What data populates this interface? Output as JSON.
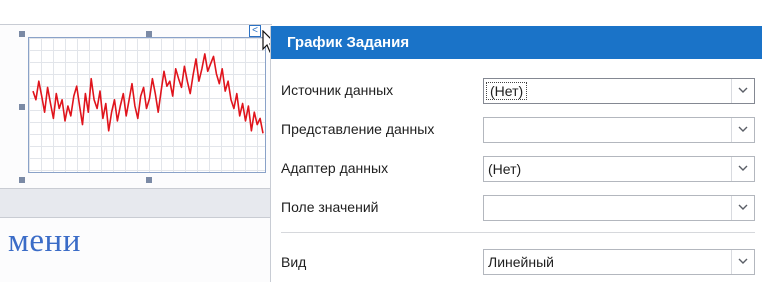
{
  "designer": {
    "footer_text": "мени",
    "smart_tag_glyph": "<"
  },
  "panel": {
    "title": "График Задания",
    "rows": [
      {
        "label": "Источник данных",
        "value": "(Нет)"
      },
      {
        "label": "Представление данных",
        "value": ""
      },
      {
        "label": "Адаптер данных",
        "value": "(Нет)"
      },
      {
        "label": "Поле значений",
        "value": ""
      },
      {
        "label": "Вид",
        "value": "Линейный"
      }
    ]
  },
  "colors": {
    "title_bar": "#1a73c8",
    "series_line": "#e0141c",
    "selection_handles": "#7b8aa5"
  },
  "icons": {
    "smart_tag": "smart-tag-icon",
    "dropdown": "chevron-down-icon",
    "cursor": "mouse-pointer-icon"
  },
  "chart_data": {
    "type": "line",
    "x": [
      0,
      1,
      2,
      3,
      4,
      5,
      6,
      7,
      8,
      9,
      10,
      11,
      12,
      13,
      14,
      15,
      16,
      17,
      18,
      19,
      20,
      21,
      22,
      23,
      24,
      25,
      26,
      27,
      28,
      29,
      30,
      31,
      32,
      33,
      34,
      35,
      36,
      37,
      38,
      39,
      40,
      41,
      42,
      43,
      44,
      45,
      46,
      47,
      48,
      49,
      50,
      51,
      52,
      53,
      54,
      55,
      56,
      57,
      58,
      59,
      60,
      61,
      62,
      63,
      64,
      65,
      66,
      67,
      68,
      69,
      70,
      71,
      72,
      73,
      74,
      75,
      76,
      77,
      78,
      79
    ],
    "y": [
      62,
      55,
      70,
      58,
      45,
      65,
      52,
      40,
      60,
      48,
      55,
      38,
      50,
      42,
      58,
      66,
      50,
      35,
      60,
      45,
      72,
      55,
      48,
      62,
      40,
      52,
      30,
      45,
      55,
      38,
      50,
      60,
      42,
      55,
      68,
      50,
      40,
      58,
      65,
      48,
      56,
      72,
      60,
      45,
      62,
      78,
      66,
      70,
      58,
      80,
      72,
      65,
      82,
      70,
      60,
      75,
      88,
      70,
      80,
      92,
      78,
      84,
      90,
      76,
      68,
      80,
      62,
      70,
      55,
      48,
      60,
      42,
      52,
      38,
      50,
      30,
      45,
      35,
      40,
      28
    ]
  }
}
